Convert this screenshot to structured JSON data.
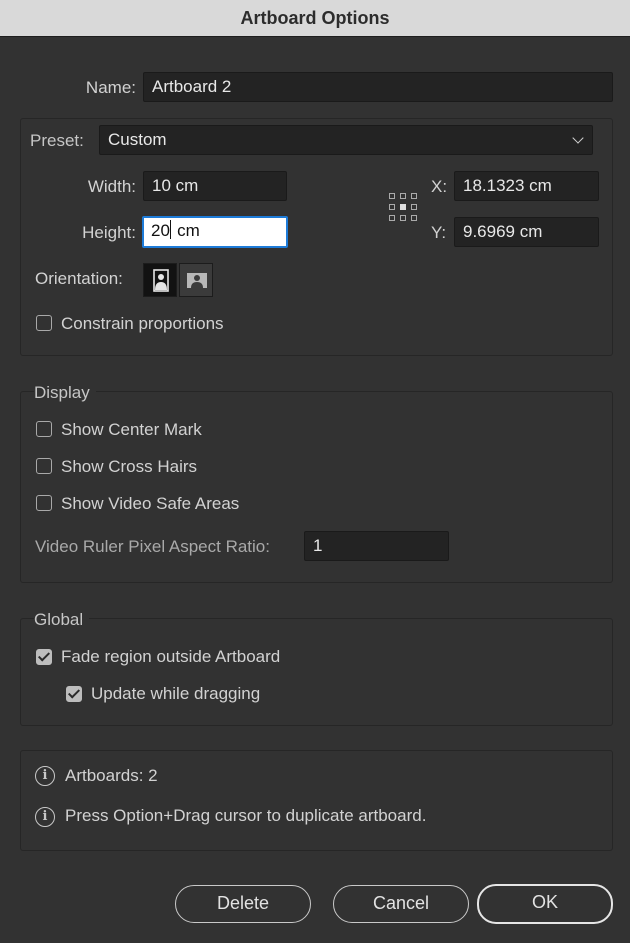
{
  "window": {
    "title": "Artboard Options"
  },
  "name": {
    "label": "Name:",
    "value": "Artboard 2"
  },
  "preset": {
    "label": "Preset:",
    "value": "Custom"
  },
  "width": {
    "label": "Width:",
    "value": "10 cm"
  },
  "height": {
    "label": "Height:",
    "value_before_caret": "20",
    "value_after_caret": " cm"
  },
  "x": {
    "label": "X:",
    "value": "18.1323 cm"
  },
  "y": {
    "label": "Y:",
    "value": "9.6969 cm"
  },
  "orientation": {
    "label": "Orientation:",
    "selected": "portrait"
  },
  "constrain": {
    "label": "Constrain proportions",
    "checked": false
  },
  "display": {
    "title": "Display",
    "center_mark": {
      "label": "Show Center Mark",
      "checked": false
    },
    "cross_hairs": {
      "label": "Show Cross Hairs",
      "checked": false
    },
    "video_safe": {
      "label": "Show Video Safe Areas",
      "checked": false
    },
    "pixel_ratio": {
      "label": "Video Ruler Pixel Aspect Ratio:",
      "value": "1"
    }
  },
  "global": {
    "title": "Global",
    "fade": {
      "label": "Fade region outside Artboard",
      "checked": true
    },
    "update_drag": {
      "label": "Update while dragging",
      "checked": true
    }
  },
  "info": {
    "artboards": "Artboards: 2",
    "hint": "Press Option+Drag cursor to duplicate artboard."
  },
  "buttons": {
    "delete": "Delete",
    "cancel": "Cancel",
    "ok": "OK"
  },
  "colors": {
    "dialog_bg": "#323232",
    "field_bg": "#232323",
    "focus_ring": "#1d7bd8"
  }
}
